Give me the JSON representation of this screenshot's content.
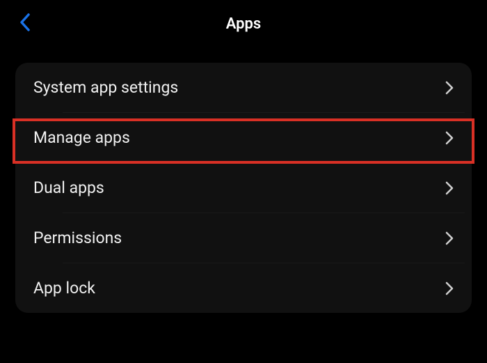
{
  "header": {
    "title": "Apps"
  },
  "settings_list": {
    "items": [
      {
        "label": "System app settings"
      },
      {
        "label": "Manage apps"
      },
      {
        "label": "Dual apps"
      },
      {
        "label": "Permissions"
      },
      {
        "label": "App lock"
      }
    ]
  },
  "highlight": {
    "target_index": 1
  }
}
